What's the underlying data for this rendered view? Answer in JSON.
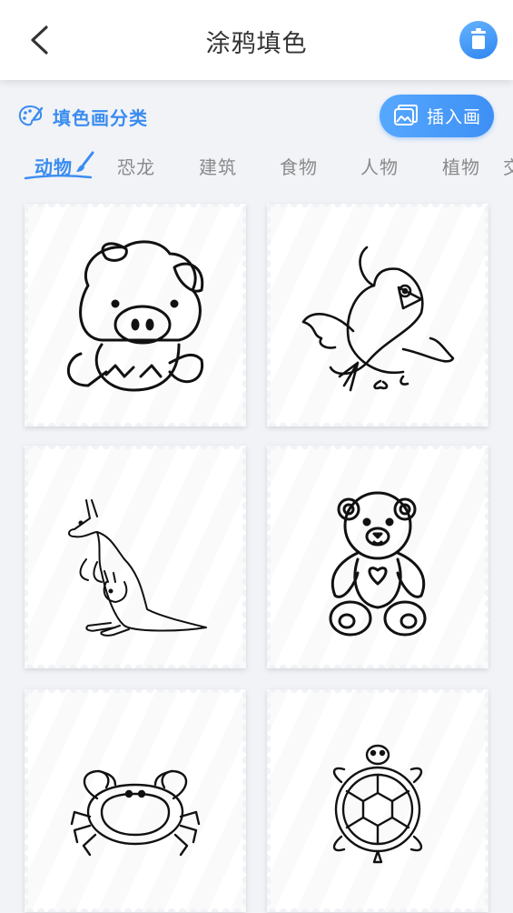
{
  "header": {
    "title": "涂鸦填色"
  },
  "category_section": {
    "title": "填色画分类",
    "insert_button_label": "插入画"
  },
  "tabs": [
    {
      "label": "动物",
      "active": true
    },
    {
      "label": "恐龙",
      "active": false
    },
    {
      "label": "建筑",
      "active": false
    },
    {
      "label": "食物",
      "active": false
    },
    {
      "label": "人物",
      "active": false
    },
    {
      "label": "植物",
      "active": false
    },
    {
      "label": "交",
      "active": false
    }
  ],
  "cards": [
    {
      "icon": "pig-drawing-icon"
    },
    {
      "icon": "bird-drawing-icon"
    },
    {
      "icon": "kangaroo-drawing-icon"
    },
    {
      "icon": "teddy-bear-drawing-icon"
    },
    {
      "icon": "crab-drawing-icon"
    },
    {
      "icon": "turtle-drawing-icon"
    }
  ],
  "colors": {
    "accent": "#3a8cf0",
    "tab_inactive": "#8a8a8a",
    "background": "#f1f3f7"
  }
}
